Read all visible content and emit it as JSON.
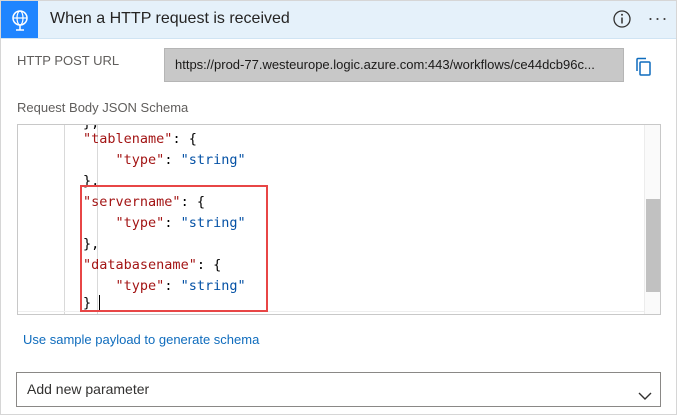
{
  "header": {
    "title": "When a HTTP request is received",
    "trigger_icon": "globe-request-icon",
    "info_icon": "info-icon",
    "more_label": "···",
    "accent": "#1f85ff"
  },
  "url": {
    "label": "HTTP POST URL",
    "value": "https://prod-77.westeurope.logic.azure.com:443/workflows/ce44dcb96c...",
    "copy_icon": "copy-icon"
  },
  "schema": {
    "label": "Request Body JSON Schema",
    "lines": [
      {
        "indent": "        ",
        "key": "\"tablename\"",
        "sep": ": ",
        "rest": "{"
      },
      {
        "indent": "            ",
        "key": "\"type\"",
        "sep": ": ",
        "rest": "\"string\""
      },
      {
        "indent": "        ",
        "key": "",
        "sep": "",
        "rest": "},"
      },
      {
        "indent": "        ",
        "key": "\"servername\"",
        "sep": ": ",
        "rest": "{"
      },
      {
        "indent": "            ",
        "key": "\"type\"",
        "sep": ": ",
        "rest": "\"string\""
      },
      {
        "indent": "        ",
        "key": "",
        "sep": "",
        "rest": "},"
      },
      {
        "indent": "        ",
        "key": "\"databasename\"",
        "sep": ": ",
        "rest": "{"
      },
      {
        "indent": "            ",
        "key": "\"type\"",
        "sep": ": ",
        "rest": "\"string\""
      },
      {
        "indent": "        ",
        "key": "",
        "sep": "",
        "rest": "}"
      }
    ],
    "highlight_color": "#e84646"
  },
  "sample_link": "Use sample payload to generate schema",
  "add_parameter": {
    "label": "Add new parameter",
    "chevron_icon": "chevron-down-icon"
  }
}
